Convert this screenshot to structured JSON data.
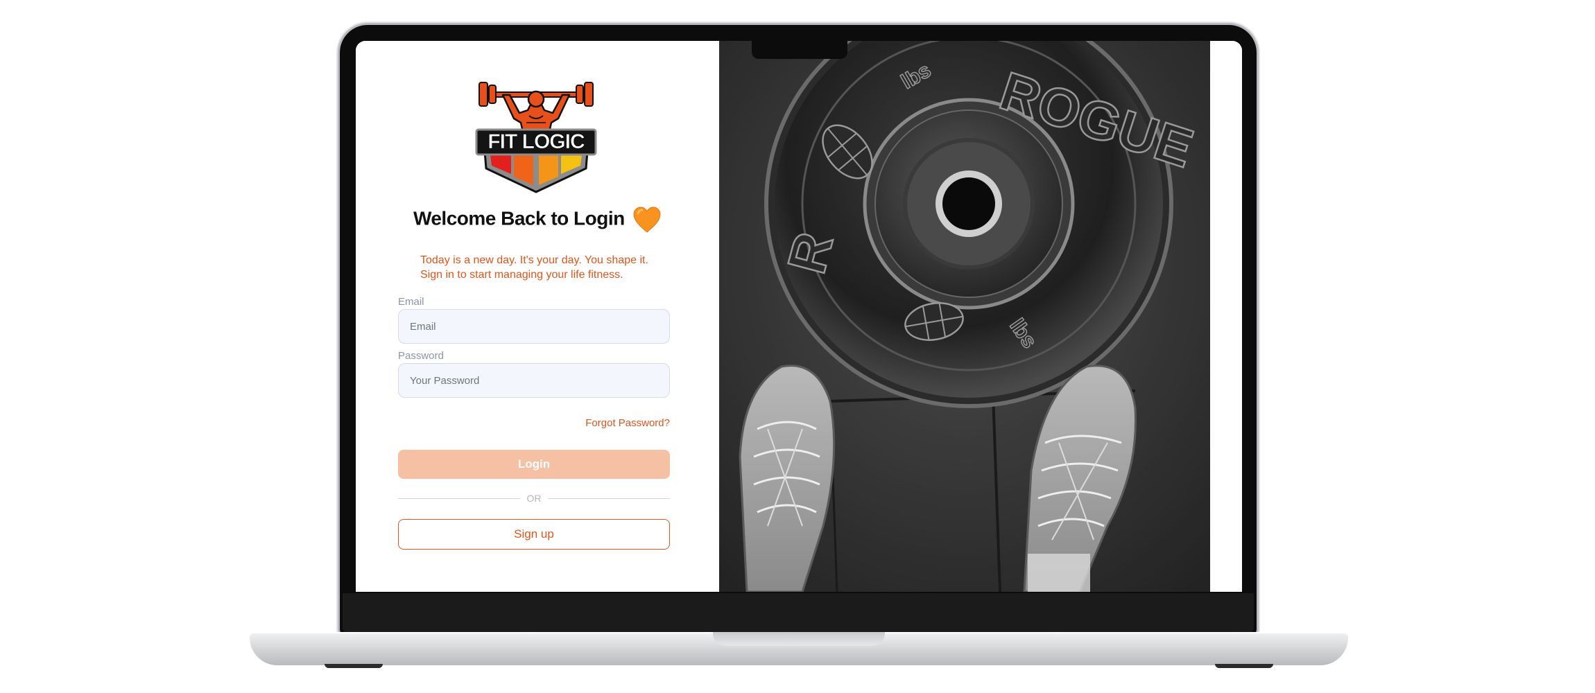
{
  "logo": {
    "text": "FIT LOGIC",
    "icon": "weightlifter-shield-logo"
  },
  "welcome": {
    "title": "Welcome Back to Login",
    "icon": "orange-heart-icon"
  },
  "tagline": {
    "line1": "Today is a new day. It's your day. You shape it.",
    "line2": "Sign in to start managing your life fitness."
  },
  "form": {
    "email_label": "Email",
    "email_placeholder": "Email",
    "email_value": "",
    "password_label": "Password",
    "password_placeholder": "Your Password",
    "password_value": "",
    "forgot_password": "Forgot Password?",
    "login_label": "Login",
    "divider_text": "OR",
    "signup_label": "Sign up"
  },
  "photo": {
    "plate_brand": "ROGUE",
    "plate_small_text": "lbs",
    "plate_letter": "R"
  },
  "colors": {
    "accent": "#e1541a",
    "login_button_bg": "#f6c0a4",
    "input_bg": "#f3f6fc",
    "label": "#8a94a6"
  }
}
